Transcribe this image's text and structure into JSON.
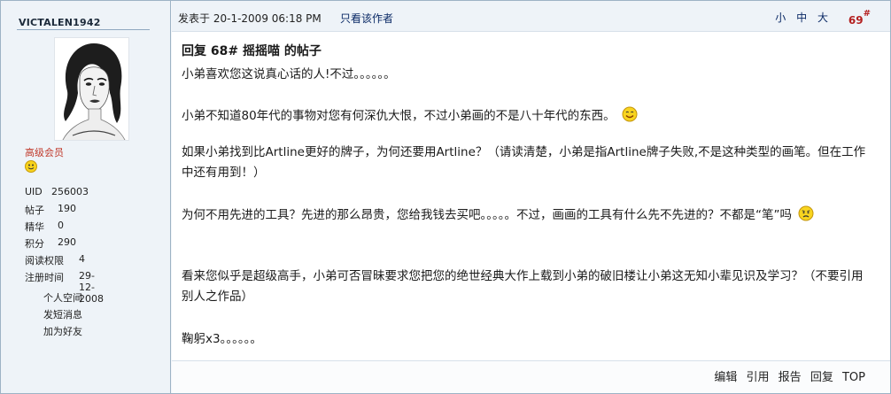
{
  "author": {
    "username": "VICTALEN1942",
    "group": "高级会员",
    "stats": [
      {
        "key": "UID",
        "value": "256003"
      },
      {
        "key": "帖子",
        "value": "190"
      },
      {
        "key": "精华",
        "value": "0"
      },
      {
        "key": "积分",
        "value": "290"
      },
      {
        "key": "阅读权限",
        "value": "4"
      },
      {
        "key": "注册时间",
        "value": "29-12-2008"
      }
    ],
    "menu": [
      "个人空间",
      "发短消息",
      "加为好友"
    ]
  },
  "post": {
    "posted_label": "发表于",
    "posted_time": "20-1-2009 06:18 PM",
    "only_author": "只看该作者",
    "size_controls": [
      "小",
      "中",
      "大"
    ],
    "floor_number": "69",
    "floor_mark": "#",
    "title": "回复  68# 摇摇喵  的帖子",
    "paragraphs": [
      "小弟喜欢您这说真心话的人!不过。。。。。。",
      "小弟不知道80年代的事物对您有何深仇大恨，不过小弟画的不是八十年代的东西。",
      "如果小弟找到比Artline更好的牌子，为何还要用Artline？（请读清楚，小弟是指Artline牌子失败,不是这种类型的画笔。但在工作中还有用到！）",
      "为何不用先进的工具？先进的那么昂贵，您给我钱去买吧。。。。。不过，画画的工具有什么先不先进的？不都是“笔”吗",
      "看来您似乎是超级高手，小弟可否冒昧要求您把您的绝世经典大作上载到小弟的破旧楼让小弟这无知小辈见识及学习？（不要引用别人之作品）",
      "鞠躬x3。。。。。。"
    ],
    "footer_links": [
      "编辑",
      "引用",
      "报告",
      "回复",
      "TOP"
    ]
  },
  "colors": {
    "header_bg": "#eef3f8",
    "border": "#9db3c5",
    "group_color": "#c0392b",
    "floor_color": "#b42020",
    "link_color": "#0b2a66"
  }
}
